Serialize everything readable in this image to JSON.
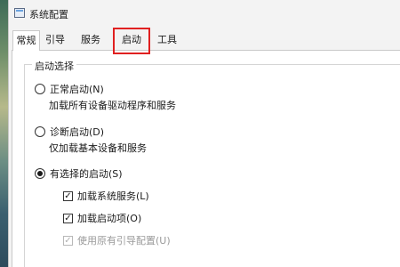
{
  "window": {
    "title": "系统配置"
  },
  "tabs": [
    {
      "label": "常规",
      "active": true
    },
    {
      "label": "引导",
      "active": false
    },
    {
      "label": "服务",
      "active": false
    },
    {
      "label": "启动",
      "active": false,
      "highlighted": true
    },
    {
      "label": "工具",
      "active": false
    }
  ],
  "startup_selection": {
    "group_title": "启动选择",
    "options": [
      {
        "label": "正常启动(N)",
        "description": "加载所有设备驱动程序和服务",
        "selected": false
      },
      {
        "label": "诊断启动(D)",
        "description": "仅加载基本设备和服务",
        "selected": false
      },
      {
        "label": "有选择的启动(S)",
        "selected": true
      }
    ],
    "selective_items": [
      {
        "label": "加载系统服务(L)",
        "checked": true,
        "enabled": true
      },
      {
        "label": "加载启动项(O)",
        "checked": true,
        "enabled": true
      },
      {
        "label": "使用原有引导配置(U)",
        "checked": true,
        "enabled": false
      }
    ]
  },
  "colors": {
    "highlight": "#e02020",
    "window_bg": "#f3f3f3",
    "panel_bg": "#ffffff"
  },
  "icons": {
    "app": "system-config-icon",
    "check": "✓"
  }
}
